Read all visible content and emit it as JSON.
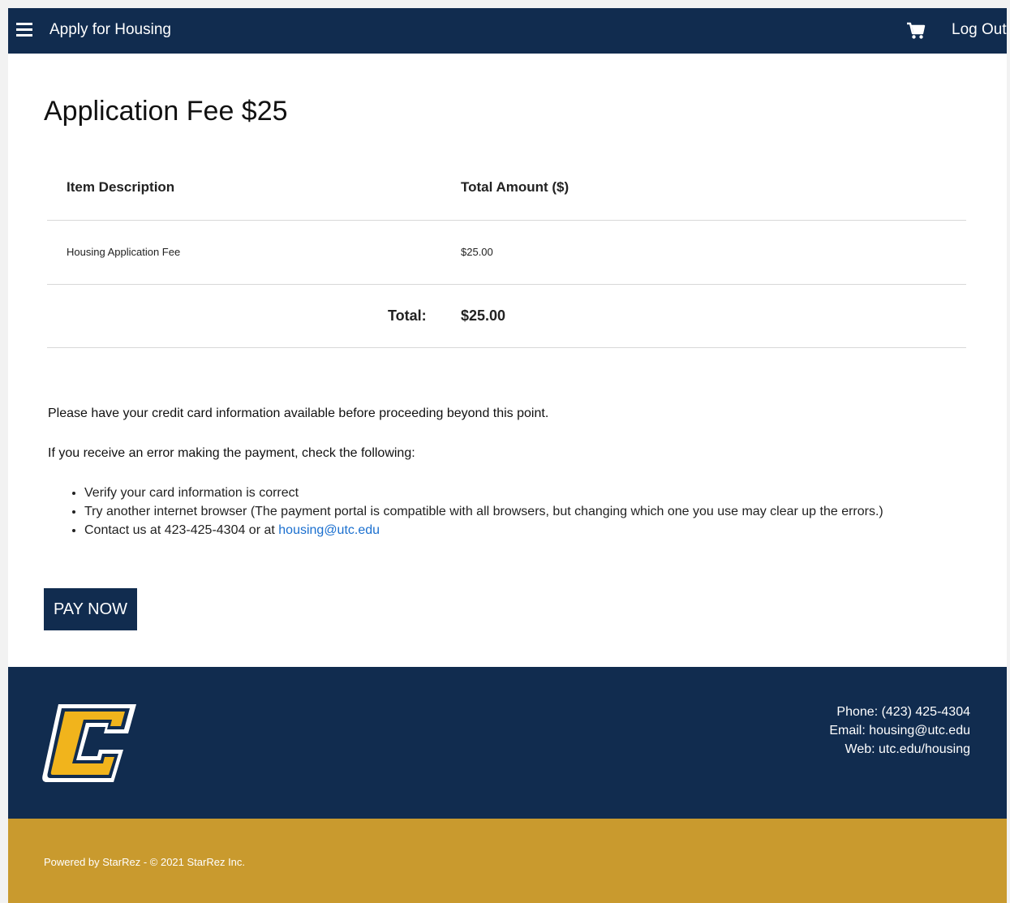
{
  "nav": {
    "title": "Apply for Housing",
    "logout": "Log Out"
  },
  "page": {
    "title": "Application Fee $25"
  },
  "table": {
    "headers": [
      "Item Description",
      "Total Amount ($)"
    ],
    "rows": [
      {
        "description": "Housing Application Fee",
        "amount": "$25.00"
      }
    ],
    "total_label": "Total:",
    "total_value": "$25.00"
  },
  "notes": {
    "credit_card": "Please have your credit card information available before proceeding beyond this point.",
    "error_intro": "If you receive an error making the payment, check the following:",
    "bullets": [
      "Verify your card information is correct",
      "Try another internet browser (The payment portal is compatible with all browsers, but changing which one you use may clear up the errors.)",
      "Contact us at 423-425-4304 or at "
    ],
    "email_link": "housing@utc.edu"
  },
  "pay_button": "PAY NOW",
  "footer": {
    "phone": "Phone: (423) 425-4304",
    "email": "Email: housing@utc.edu",
    "web": "Web: utc.edu/housing",
    "powered": "Powered by StarRez - © 2021 StarRez Inc."
  },
  "colors": {
    "navy": "#112c4f",
    "gold": "#c99a2e",
    "link": "#1a6fcf"
  },
  "icons": {
    "menu": "hamburger-menu-icon",
    "cart": "shopping-cart-icon",
    "logo": "utc-c-logo"
  }
}
